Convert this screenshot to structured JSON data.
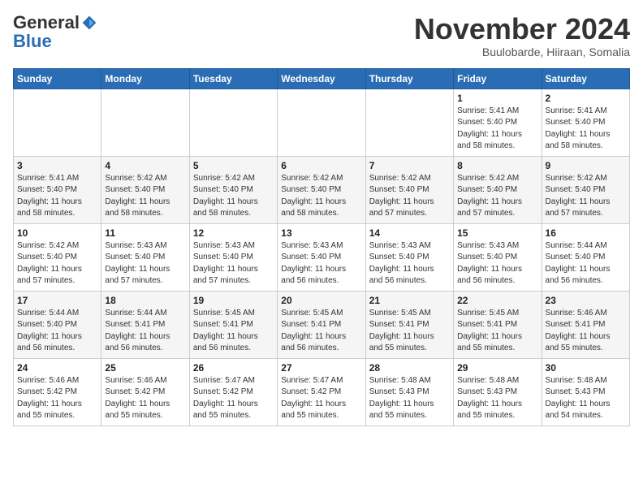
{
  "header": {
    "logo_general": "General",
    "logo_blue": "Blue",
    "month_title": "November 2024",
    "location": "Buulobarde, Hiiraan, Somalia"
  },
  "days_of_week": [
    "Sunday",
    "Monday",
    "Tuesday",
    "Wednesday",
    "Thursday",
    "Friday",
    "Saturday"
  ],
  "weeks": [
    [
      {
        "day": "",
        "info": ""
      },
      {
        "day": "",
        "info": ""
      },
      {
        "day": "",
        "info": ""
      },
      {
        "day": "",
        "info": ""
      },
      {
        "day": "",
        "info": ""
      },
      {
        "day": "1",
        "info": "Sunrise: 5:41 AM\nSunset: 5:40 PM\nDaylight: 11 hours\nand 58 minutes."
      },
      {
        "day": "2",
        "info": "Sunrise: 5:41 AM\nSunset: 5:40 PM\nDaylight: 11 hours\nand 58 minutes."
      }
    ],
    [
      {
        "day": "3",
        "info": "Sunrise: 5:41 AM\nSunset: 5:40 PM\nDaylight: 11 hours\nand 58 minutes."
      },
      {
        "day": "4",
        "info": "Sunrise: 5:42 AM\nSunset: 5:40 PM\nDaylight: 11 hours\nand 58 minutes."
      },
      {
        "day": "5",
        "info": "Sunrise: 5:42 AM\nSunset: 5:40 PM\nDaylight: 11 hours\nand 58 minutes."
      },
      {
        "day": "6",
        "info": "Sunrise: 5:42 AM\nSunset: 5:40 PM\nDaylight: 11 hours\nand 58 minutes."
      },
      {
        "day": "7",
        "info": "Sunrise: 5:42 AM\nSunset: 5:40 PM\nDaylight: 11 hours\nand 57 minutes."
      },
      {
        "day": "8",
        "info": "Sunrise: 5:42 AM\nSunset: 5:40 PM\nDaylight: 11 hours\nand 57 minutes."
      },
      {
        "day": "9",
        "info": "Sunrise: 5:42 AM\nSunset: 5:40 PM\nDaylight: 11 hours\nand 57 minutes."
      }
    ],
    [
      {
        "day": "10",
        "info": "Sunrise: 5:42 AM\nSunset: 5:40 PM\nDaylight: 11 hours\nand 57 minutes."
      },
      {
        "day": "11",
        "info": "Sunrise: 5:43 AM\nSunset: 5:40 PM\nDaylight: 11 hours\nand 57 minutes."
      },
      {
        "day": "12",
        "info": "Sunrise: 5:43 AM\nSunset: 5:40 PM\nDaylight: 11 hours\nand 57 minutes."
      },
      {
        "day": "13",
        "info": "Sunrise: 5:43 AM\nSunset: 5:40 PM\nDaylight: 11 hours\nand 56 minutes."
      },
      {
        "day": "14",
        "info": "Sunrise: 5:43 AM\nSunset: 5:40 PM\nDaylight: 11 hours\nand 56 minutes."
      },
      {
        "day": "15",
        "info": "Sunrise: 5:43 AM\nSunset: 5:40 PM\nDaylight: 11 hours\nand 56 minutes."
      },
      {
        "day": "16",
        "info": "Sunrise: 5:44 AM\nSunset: 5:40 PM\nDaylight: 11 hours\nand 56 minutes."
      }
    ],
    [
      {
        "day": "17",
        "info": "Sunrise: 5:44 AM\nSunset: 5:40 PM\nDaylight: 11 hours\nand 56 minutes."
      },
      {
        "day": "18",
        "info": "Sunrise: 5:44 AM\nSunset: 5:41 PM\nDaylight: 11 hours\nand 56 minutes."
      },
      {
        "day": "19",
        "info": "Sunrise: 5:45 AM\nSunset: 5:41 PM\nDaylight: 11 hours\nand 56 minutes."
      },
      {
        "day": "20",
        "info": "Sunrise: 5:45 AM\nSunset: 5:41 PM\nDaylight: 11 hours\nand 56 minutes."
      },
      {
        "day": "21",
        "info": "Sunrise: 5:45 AM\nSunset: 5:41 PM\nDaylight: 11 hours\nand 55 minutes."
      },
      {
        "day": "22",
        "info": "Sunrise: 5:45 AM\nSunset: 5:41 PM\nDaylight: 11 hours\nand 55 minutes."
      },
      {
        "day": "23",
        "info": "Sunrise: 5:46 AM\nSunset: 5:41 PM\nDaylight: 11 hours\nand 55 minutes."
      }
    ],
    [
      {
        "day": "24",
        "info": "Sunrise: 5:46 AM\nSunset: 5:42 PM\nDaylight: 11 hours\nand 55 minutes."
      },
      {
        "day": "25",
        "info": "Sunrise: 5:46 AM\nSunset: 5:42 PM\nDaylight: 11 hours\nand 55 minutes."
      },
      {
        "day": "26",
        "info": "Sunrise: 5:47 AM\nSunset: 5:42 PM\nDaylight: 11 hours\nand 55 minutes."
      },
      {
        "day": "27",
        "info": "Sunrise: 5:47 AM\nSunset: 5:42 PM\nDaylight: 11 hours\nand 55 minutes."
      },
      {
        "day": "28",
        "info": "Sunrise: 5:48 AM\nSunset: 5:43 PM\nDaylight: 11 hours\nand 55 minutes."
      },
      {
        "day": "29",
        "info": "Sunrise: 5:48 AM\nSunset: 5:43 PM\nDaylight: 11 hours\nand 55 minutes."
      },
      {
        "day": "30",
        "info": "Sunrise: 5:48 AM\nSunset: 5:43 PM\nDaylight: 11 hours\nand 54 minutes."
      }
    ]
  ]
}
